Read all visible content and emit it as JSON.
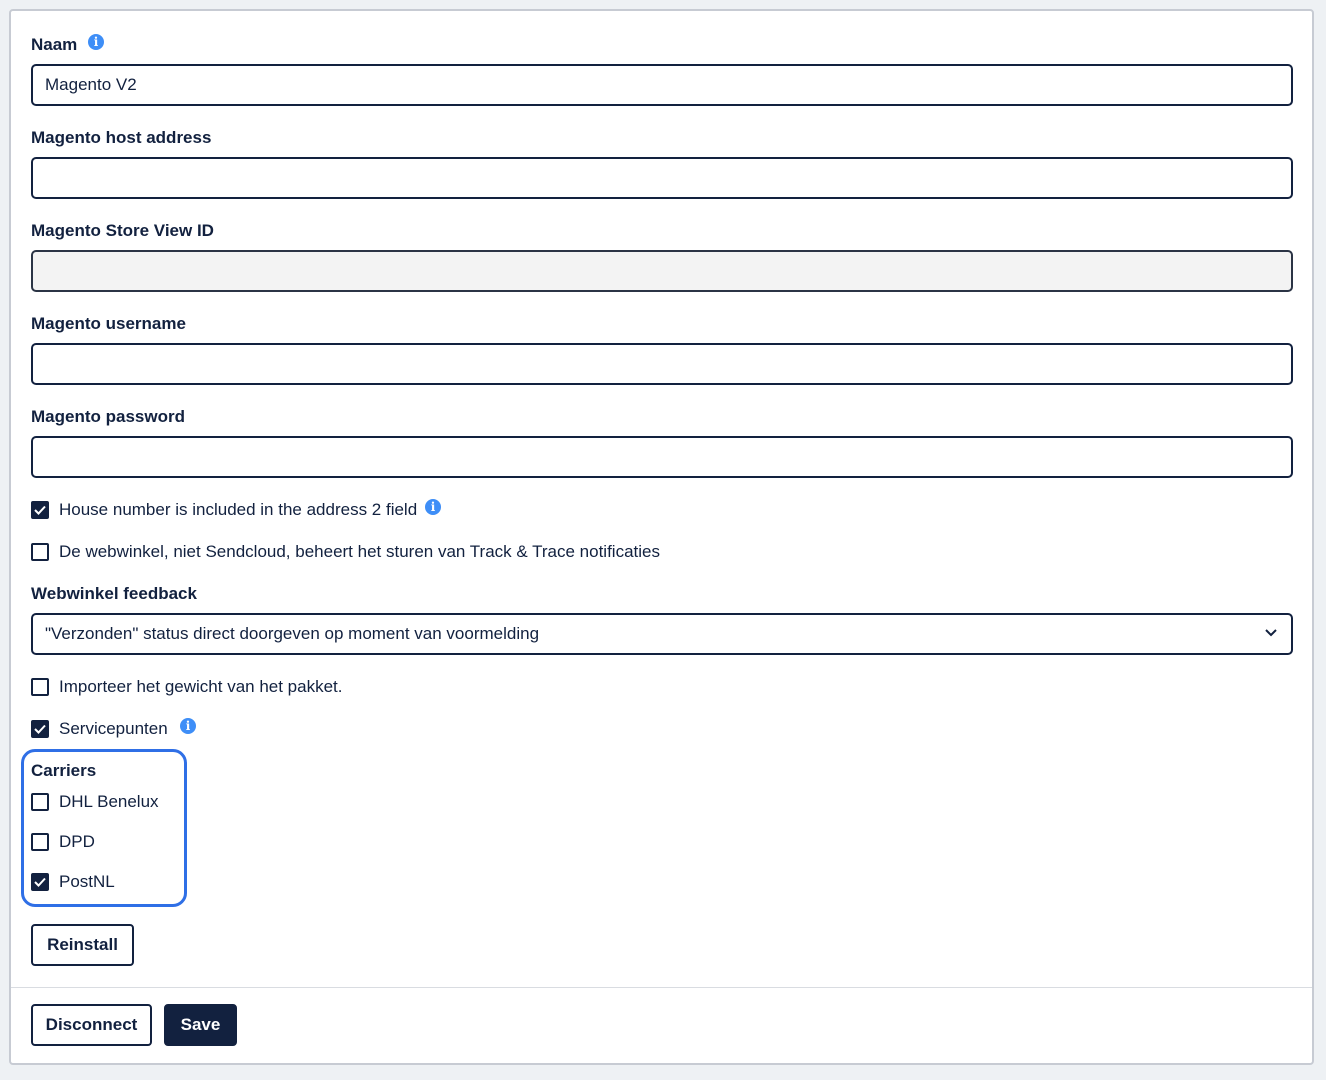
{
  "fields": {
    "name": {
      "label": "Naam",
      "value": "Magento V2"
    },
    "host": {
      "label": "Magento host address",
      "value": ""
    },
    "store_view": {
      "label": "Magento Store View ID",
      "value": ""
    },
    "username": {
      "label": "Magento username",
      "value": ""
    },
    "password": {
      "label": "Magento password",
      "value": ""
    }
  },
  "options": {
    "house_number": {
      "label": "House number is included in the address 2 field",
      "checked": true
    },
    "track_trace": {
      "label": "De webwinkel, niet Sendcloud, beheert het sturen van Track & Trace notificaties",
      "checked": false
    }
  },
  "feedback": {
    "label": "Webwinkel feedback",
    "selected": "\"Verzonden\" status direct doorgeven op moment van voormelding"
  },
  "import_weight": {
    "label": "Importeer het gewicht van het pakket.",
    "checked": false
  },
  "service_points": {
    "label": "Servicepunten",
    "checked": true
  },
  "carriers": {
    "label": "Carriers",
    "items": [
      {
        "label": "DHL Benelux",
        "checked": false
      },
      {
        "label": "DPD",
        "checked": false
      },
      {
        "label": "PostNL",
        "checked": true
      }
    ]
  },
  "buttons": {
    "reinstall": "Reinstall",
    "disconnect": "Disconnect",
    "save": "Save"
  },
  "icons": {
    "info": "info-icon",
    "check": "check-icon",
    "chevron": "chevron-down-icon"
  },
  "colors": {
    "primary": "#12213f",
    "info": "#3e8ef7",
    "highlight": "#2f6fe6"
  }
}
